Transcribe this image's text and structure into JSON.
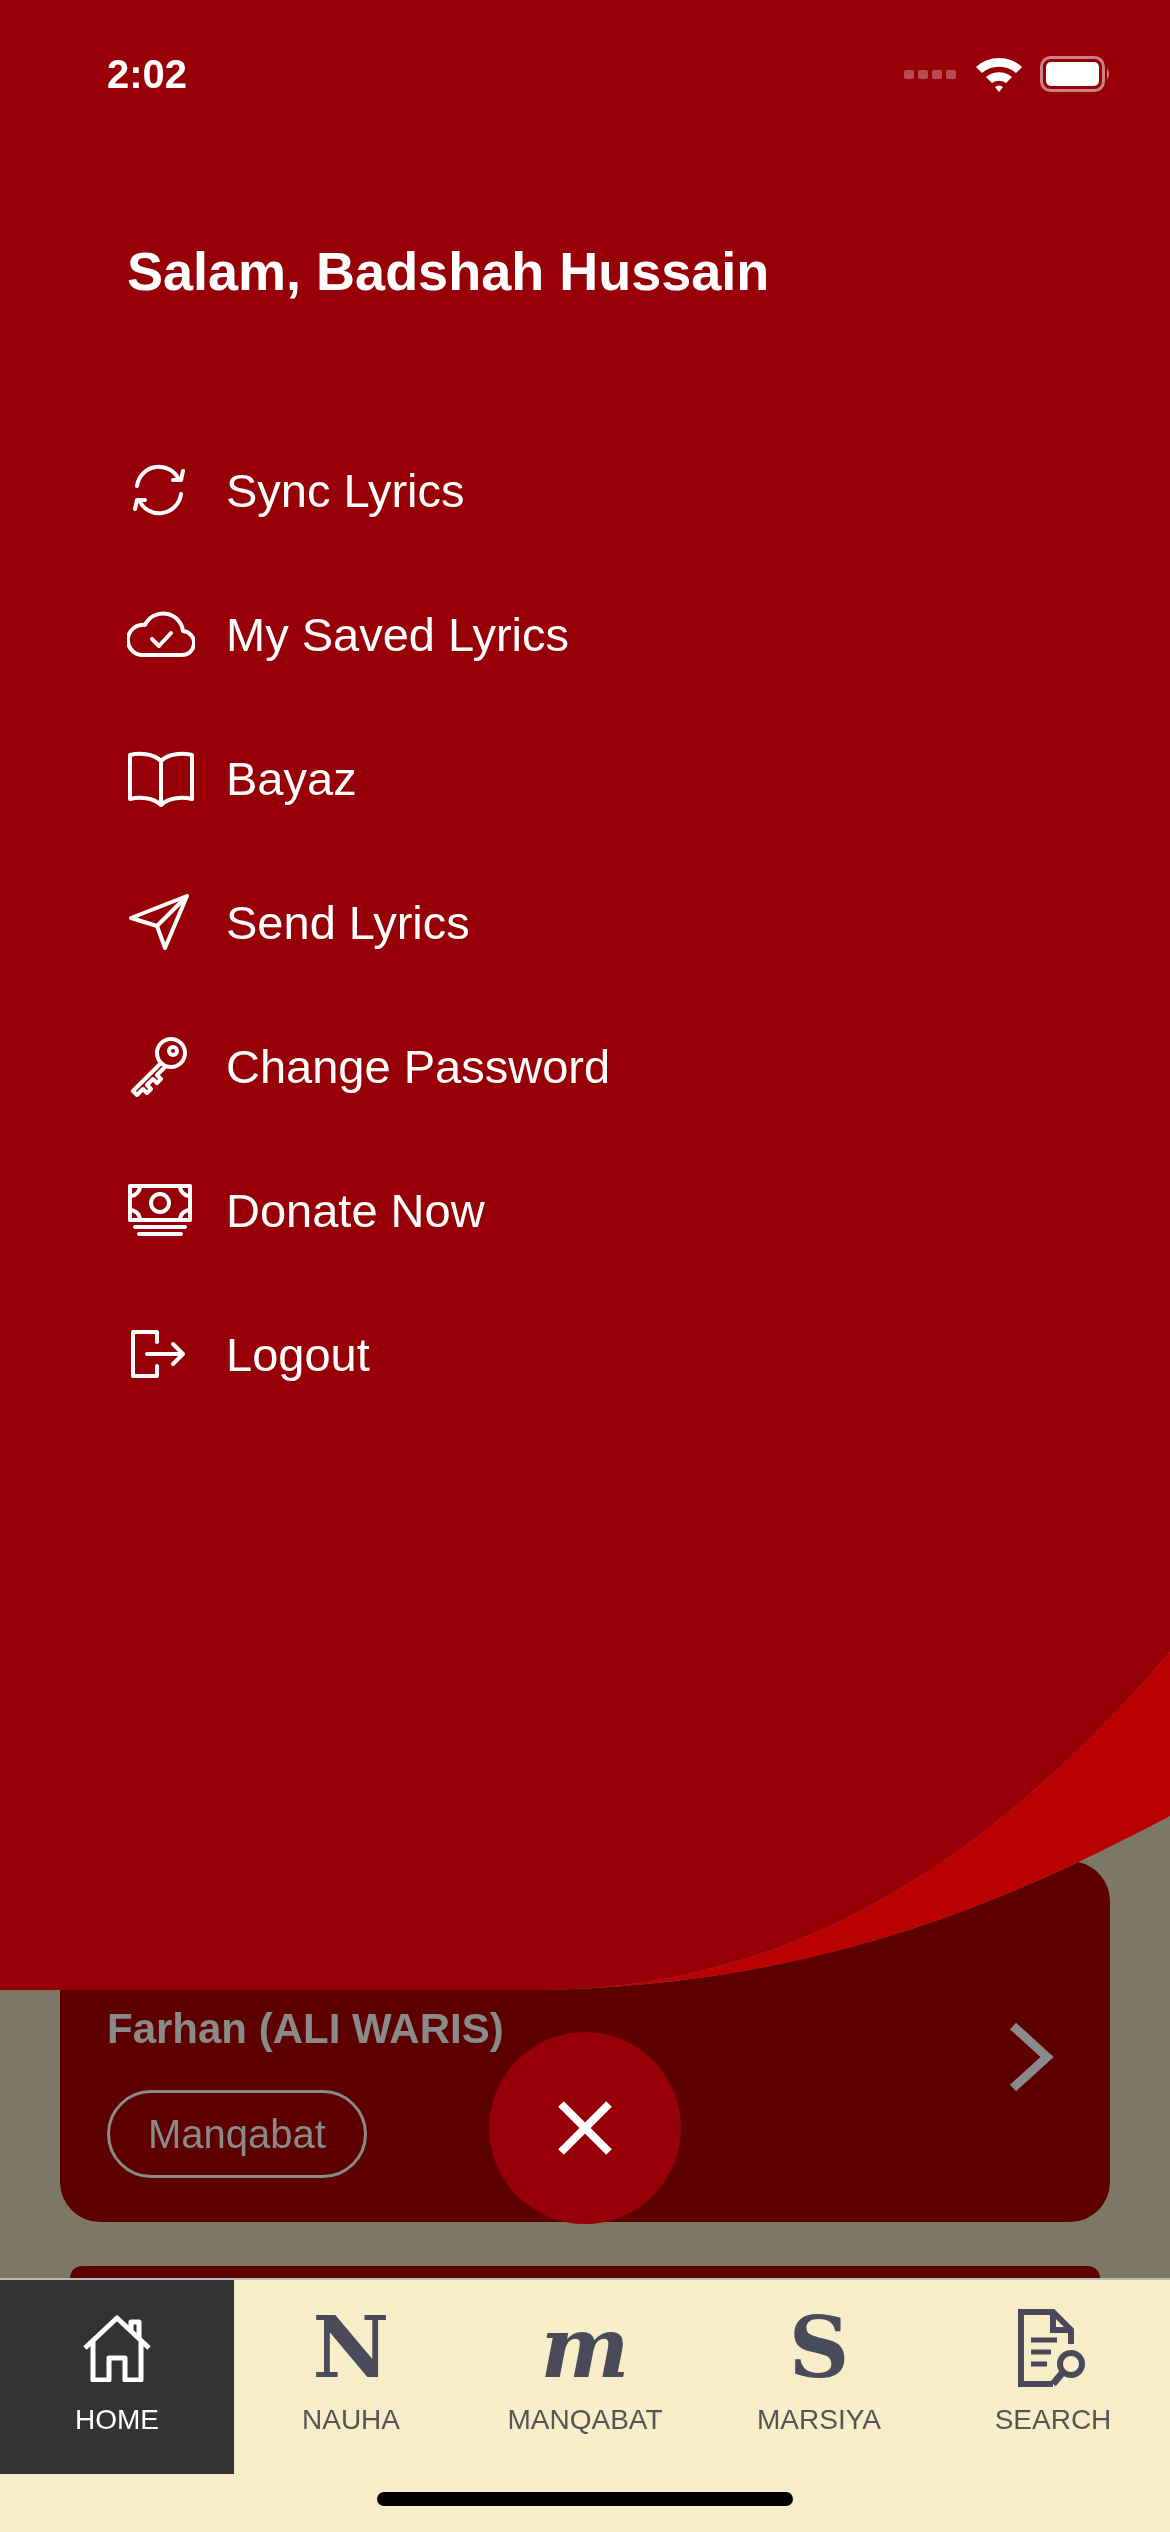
{
  "status_bar": {
    "time": "2:02"
  },
  "drawer": {
    "greeting": "Salam, Badshah Hussain",
    "items": [
      {
        "kind": "sync",
        "label": "Sync Lyrics"
      },
      {
        "kind": "cloud",
        "label": "My Saved Lyrics"
      },
      {
        "kind": "book",
        "label": "Bayaz"
      },
      {
        "kind": "send",
        "label": "Send Lyrics"
      },
      {
        "kind": "key",
        "label": "Change Password"
      },
      {
        "kind": "money",
        "label": "Donate Now"
      },
      {
        "kind": "logout",
        "label": "Logout"
      }
    ]
  },
  "card": {
    "title": "Farhan (ALI WARIS)",
    "tag": "Manqabat"
  },
  "tab_bar": [
    {
      "kind": "home",
      "label": "HOME",
      "selected": true
    },
    {
      "kind": "glyph",
      "glyph": "N",
      "label": "NAUHA",
      "selected": false
    },
    {
      "kind": "glyph",
      "glyph": "m",
      "label": "MANQABAT",
      "selected": false
    },
    {
      "kind": "glyph",
      "glyph": "S",
      "label": "MARSIYA",
      "selected": false
    },
    {
      "kind": "search",
      "label": "SEARCH",
      "selected": false
    }
  ]
}
